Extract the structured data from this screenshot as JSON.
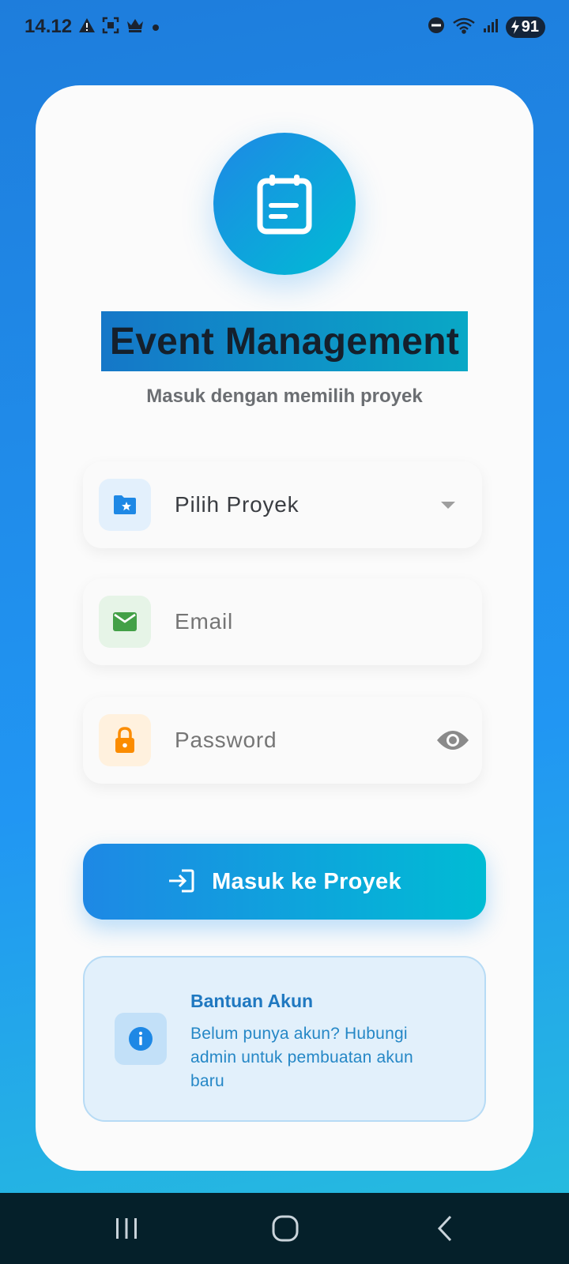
{
  "status_bar": {
    "time": "14.12",
    "left_icons": [
      "warning-icon",
      "screenshot-icon",
      "crown-icon",
      "dot-icon"
    ],
    "right_icons": [
      "dnd-icon",
      "wifi-icon",
      "signal-icon"
    ],
    "battery": "91"
  },
  "app": {
    "logo_icon": "calendar-note-icon",
    "title": "Event Management",
    "subtitle": "Masuk dengan memilih proyek"
  },
  "form": {
    "project": {
      "placeholder": "Pilih Proyek",
      "icon": "folder-star-icon",
      "trailing_icon": "dropdown-arrow-icon"
    },
    "email": {
      "placeholder": "Email",
      "icon": "mail-icon"
    },
    "password": {
      "placeholder": "Password",
      "icon": "lock-icon",
      "trailing_icon": "eye-icon"
    }
  },
  "login_button": {
    "label": "Masuk ke Proyek",
    "icon": "login-icon"
  },
  "help": {
    "icon": "info-icon",
    "title": "Bantuan Akun",
    "text": "Belum punya akun? Hubungi admin untuk pembuatan akun baru"
  },
  "nav_bar": {
    "buttons": [
      "recents-button",
      "home-button",
      "back-button"
    ]
  },
  "colors": {
    "accent_blue": "#1e88e5",
    "accent_cyan": "#00bcd4",
    "mail_green": "#43a047",
    "lock_orange": "#fb8c00",
    "help_blue": "#1f78c0"
  }
}
